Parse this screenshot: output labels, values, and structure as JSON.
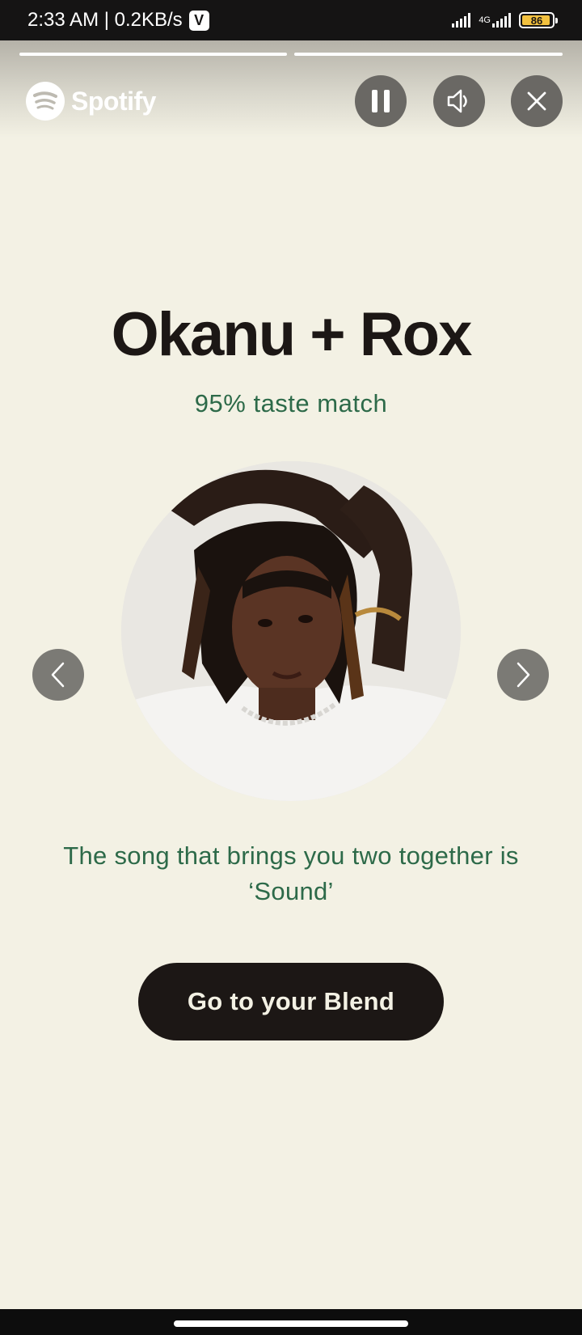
{
  "status_bar": {
    "time_speed": "2:33 AM | 0.2KB/s",
    "app_badge": "V",
    "network": "4G",
    "battery": "86"
  },
  "header": {
    "logo_text": "Spotify",
    "story_segments": 2
  },
  "main": {
    "title": "Okanu + Rox",
    "taste_match": "95% taste match",
    "song_line_1": "The song that brings you two together is",
    "song_line_2": "‘Sound’",
    "cta_label": "Go to your Blend"
  },
  "icons": {
    "pause": "pause-icon",
    "sound": "speaker-icon",
    "close": "close-icon",
    "prev": "chevron-left-icon",
    "next": "chevron-right-icon"
  },
  "colors": {
    "background": "#f3f1e4",
    "accent_green": "#2d6a49",
    "button_dark": "#1c1715"
  }
}
